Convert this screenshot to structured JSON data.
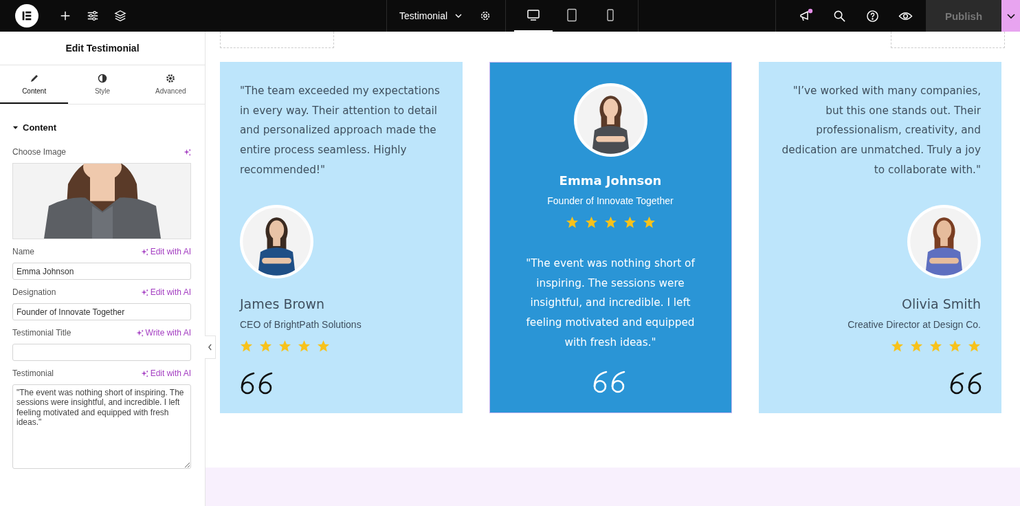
{
  "topbar": {
    "document_title": "Testimonial",
    "notification": true,
    "devices": [
      {
        "kind": "desktop",
        "selected": true
      },
      {
        "kind": "tablet",
        "selected": false
      },
      {
        "kind": "mobile",
        "selected": false
      }
    ],
    "publish": {
      "label": "Publish",
      "disabled": true
    }
  },
  "panel": {
    "title": "Edit Testimonial",
    "tabs": [
      {
        "kind": "content",
        "label": "Content",
        "selected": true
      },
      {
        "kind": "style",
        "label": "Style",
        "selected": false
      },
      {
        "kind": "advanced",
        "label": "Advanced",
        "selected": false
      }
    ],
    "section": {
      "title": "Content",
      "expanded": true
    },
    "fields": [
      {
        "label": "Choose Image"
      },
      {
        "kind": "text",
        "label": "Name",
        "ai_action": "Edit with AI",
        "value": "Emma Johnson"
      },
      {
        "kind": "text",
        "label": "Designation",
        "ai_action": "Edit with AI",
        "value": "Founder of Innovate Together"
      },
      {
        "kind": "text",
        "label": "Testimonial Title",
        "ai_action": "Write with AI"
      },
      {
        "kind": "textarea",
        "label": "Testimonial",
        "ai_action": "Edit with AI",
        "value": "\"The event was nothing short of inspiring. The sessions were insightful, and incredible. I left feeling motivated and equipped with fresh ideas.\""
      }
    ]
  },
  "cards": [
    {
      "kind": "quote-left",
      "selected": false,
      "quote": "\"The team exceeded my expectations in every way. Their attention to detail and personalized approach made the entire process seamless. Highly recommended!\"",
      "name": "James Brown",
      "designation": "CEO of BrightPath Solutions",
      "stars": 5
    },
    {
      "kind": "photo-center",
      "selected": true,
      "quote": "\"The event was nothing short of inspiring. The sessions were insightful, and incredible. I left feeling motivated and equipped with fresh ideas.\"",
      "name": "Emma Johnson",
      "designation": "Founder of Innovate Together",
      "stars": 5
    },
    {
      "kind": "quote-right",
      "selected": false,
      "quote": "\"I’ve worked with many companies, but this one stands out. Their professionalism, creativity, and dedication are unmatched. Truly a joy to collaborate with.\"",
      "name": "Olivia Smith",
      "designation": "Creative Director at Design Co.",
      "stars": 5
    }
  ]
}
